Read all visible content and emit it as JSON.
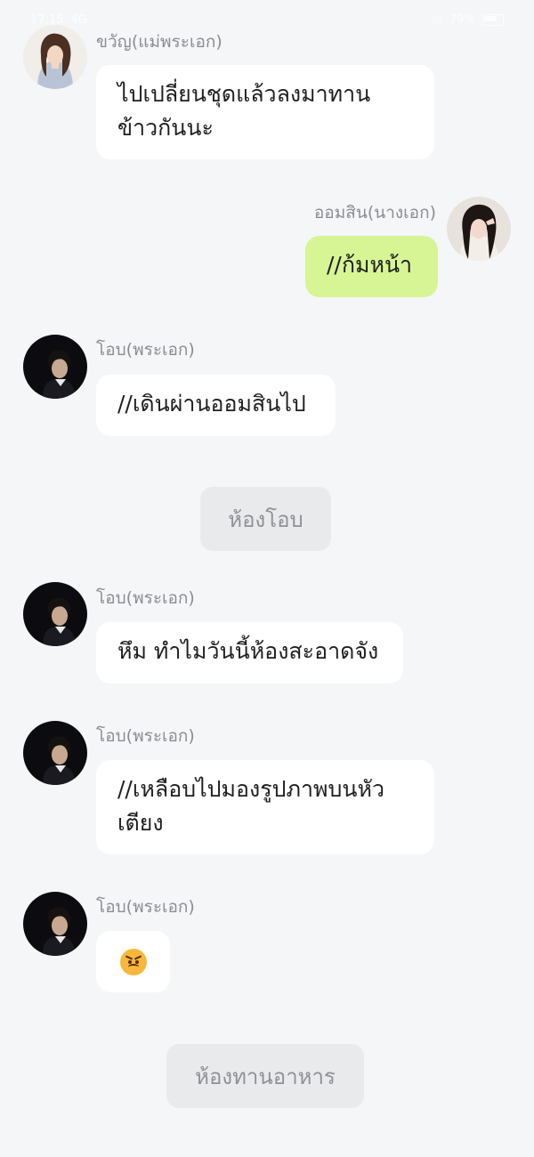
{
  "status_bar": {
    "time": "17:15",
    "network": "4G",
    "battery": "79%"
  },
  "messages": [
    {
      "name": "ขวัญ(แม่พระเอก)",
      "text": "ไปเปลี่ยนชุดแล้วลงมาทานข้าวกันนะ",
      "line1": "ไปเปลี่ยนชุดแล้วลงมาทาน",
      "line2": "ข้าวกันนะ",
      "avatar": "woman-portrait-avatar"
    },
    {
      "name": "ออมสิน(นางเอก)",
      "text": "//ก้มหน้า",
      "avatar": "girl-portrait-avatar"
    },
    {
      "name": "โอบ(พระเอก)",
      "text": "//เดินผ่านออมสินไป",
      "avatar": "man-dark-portrait-avatar"
    },
    {
      "name": "โอบ(พระเอก)",
      "text": "หึม ทำไมวันนี้ห้องสะอาดจัง",
      "avatar": "man-dark-portrait-avatar"
    },
    {
      "name": "โอบ(พระเอก)",
      "text": "//เหลือบไปมองรูปภาพบนหัวเตียง",
      "line1": "//เหลือบไปมองรูปภาพบนหัว",
      "line2": "เตียง",
      "avatar": "man-dark-portrait-avatar"
    },
    {
      "name": "โอบ(พระเอก)",
      "emoji": "angry-face-emoji",
      "avatar": "man-dark-portrait-avatar"
    }
  ],
  "scenes": [
    {
      "label": "ห้องโอบ"
    },
    {
      "label": "ห้องทานอาหาร"
    }
  ],
  "colors": {
    "background": "#f5f6f8",
    "my_bubble": "#d7f594",
    "other_bubble": "#ffffff",
    "scene_chip": "#e9eaec"
  }
}
